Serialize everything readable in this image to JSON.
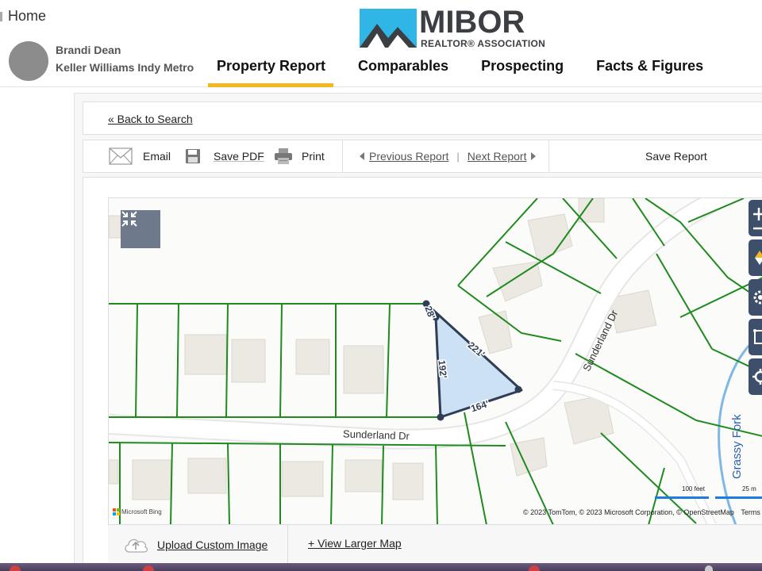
{
  "header": {
    "home_label": "Home",
    "user_name": "Brandi Dean",
    "user_office": "Keller Williams Indy Metro S",
    "logo_word": "MIBOR",
    "logo_sub": "REALTOR® ASSOCIATION",
    "nav": [
      {
        "label": "Property Report",
        "active": true
      },
      {
        "label": "Comparables",
        "active": false
      },
      {
        "label": "Prospecting",
        "active": false
      },
      {
        "label": "Facts & Figures",
        "active": false
      }
    ],
    "accent_color": "#f5b823"
  },
  "back_link": "« Back to Search",
  "toolbar": {
    "email": "Email",
    "save_pdf": "Save PDF",
    "print": "Print",
    "previous_report": "Previous Report",
    "separator": "|",
    "next_report": "Next Report",
    "save_report": "Save Report"
  },
  "map": {
    "street_label_1": "Sunderland Dr",
    "street_label_2": "Sunderland Dr",
    "creek_label": "Grassy Fork",
    "parcel_dims": [
      "28'",
      "221'",
      "192'",
      "164'"
    ],
    "parcel_fill": "#cde1f5",
    "lot_line_color": "#1f8a1f",
    "attribution": "© 2023 TomTom, © 2023 Microsoft Corporation, © OpenStreetMap",
    "terms": "Terms",
    "bing": "Microsoft Bing",
    "scale_feet": "100 feet",
    "scale_m": "25 m",
    "controls": [
      "plus-icon",
      "compass-icon",
      "gear-icon",
      "draw-icon",
      "location-icon"
    ]
  },
  "footer": {
    "upload": "Upload Custom Image",
    "larger_map": "+ View Larger Map"
  }
}
